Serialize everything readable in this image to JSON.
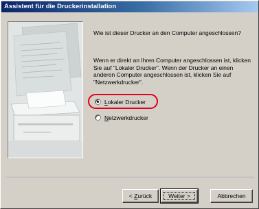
{
  "window": {
    "title": "Assistent für die Druckerinstallation"
  },
  "content": {
    "question": "Wie ist dieser Drucker an den Computer angeschlossen?",
    "description": "Wenn er direkt an Ihren Computer angeschlossen ist, klicken Sie auf \"Lokaler Drucker\". Wenn der Drucker an einen anderen Computer angeschlossen ist, klicken Sie auf \"Netzwerkdrucker\"."
  },
  "options": {
    "local": {
      "mnemonic": "L",
      "rest": "okaler Drucker",
      "selected": true
    },
    "network": {
      "mnemonic": "N",
      "rest": "etzwerkdrucker",
      "selected": false
    }
  },
  "buttons": {
    "back_prefix": "< ",
    "back_mnemonic": "Z",
    "back_rest": "urück",
    "next_label": "Weiter >",
    "cancel_label": "Abbrechen"
  },
  "colors": {
    "highlight": "#e0001a",
    "title_start": "#0a246a",
    "title_end": "#a6caf0"
  }
}
